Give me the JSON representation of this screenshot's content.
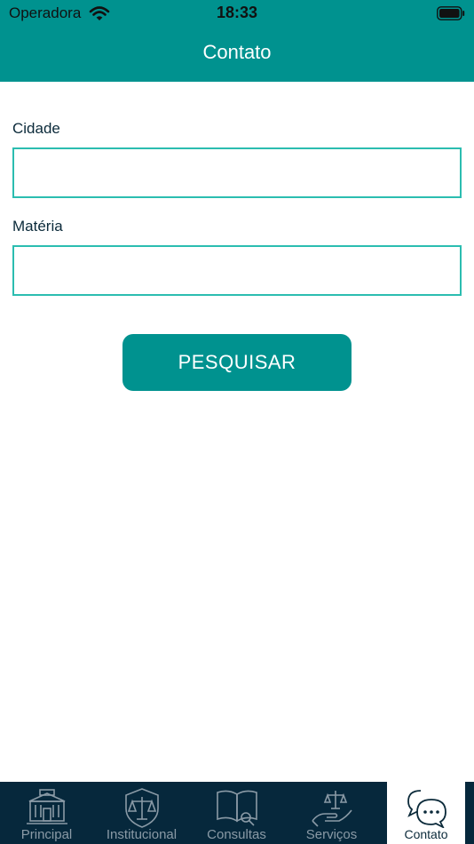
{
  "status_bar": {
    "carrier": "Operadora",
    "time": "18:33"
  },
  "header": {
    "title": "Contato"
  },
  "form": {
    "cidade_label": "Cidade",
    "cidade_value": "",
    "materia_label": "Matéria",
    "materia_value": "",
    "search_label": "PESQUISAR"
  },
  "tabs": [
    {
      "label": "Principal",
      "icon": "building-icon",
      "active": false
    },
    {
      "label": "Institucional",
      "icon": "shield-scales-icon",
      "active": false
    },
    {
      "label": "Consultas",
      "icon": "book-search-icon",
      "active": false
    },
    {
      "label": "Serviços",
      "icon": "hand-scales-icon",
      "active": false
    },
    {
      "label": "Contato",
      "icon": "chat-bubbles-icon",
      "active": true
    }
  ],
  "colors": {
    "primary": "#00928f",
    "input_border": "#2bbdb0",
    "tab_bar": "#06283c",
    "tab_inactive": "#8a9aa6"
  }
}
